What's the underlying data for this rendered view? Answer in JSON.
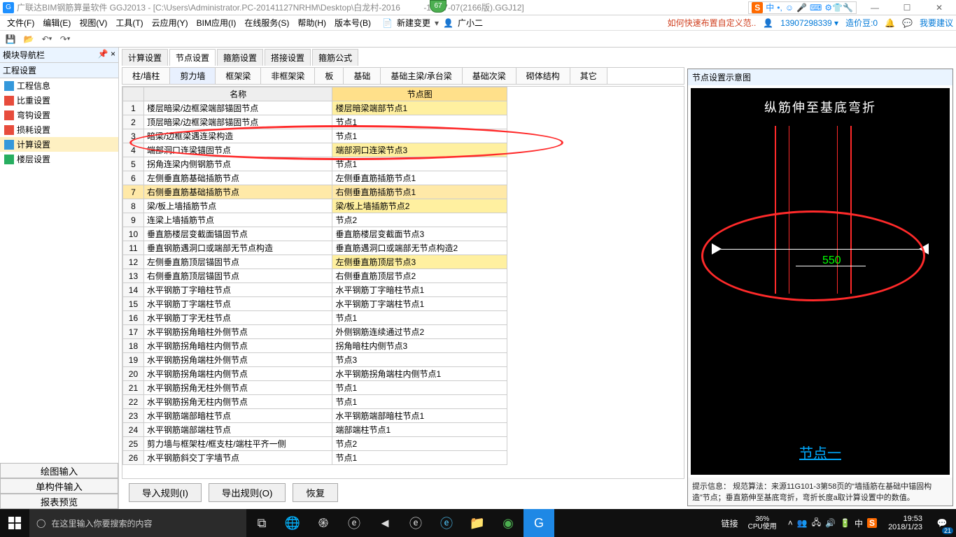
{
  "titlebar": {
    "app_name": "广联达BIM钢筋算量软件 GGJ2013",
    "file_path": "[C:\\Users\\Administrator.PC-20141127NRHM\\Desktop\\白龙村-2016",
    "file_suffix": "-13-27-07(2166版).GGJ12]",
    "badge": "67"
  },
  "ime": {
    "s": "S",
    "lang": "中",
    "punct": "•,",
    "emoji": "☺",
    "mic": "🎤",
    "kb": "⌨",
    "extras": "⚙👕🔧"
  },
  "winctrl": {
    "min": "—",
    "max": "☐",
    "close": "✕"
  },
  "menu": {
    "items": [
      "文件(F)",
      "编辑(E)",
      "视图(V)",
      "工具(T)",
      "云应用(Y)",
      "BIM应用(I)",
      "在线服务(S)",
      "帮助(H)",
      "版本号(B)"
    ],
    "new_change": "新建变更",
    "user": "广小二",
    "tip_link": "如何快速布置自定义范..",
    "phone": "13907298339",
    "price": "造价豆:0",
    "feedback": "我要建议"
  },
  "toolbar": {
    "save": "💾",
    "open": "📂",
    "undo": "↶",
    "redo": "↷"
  },
  "left": {
    "nav_title": "模块导航栏",
    "pin": "📌",
    "close": "×",
    "section": "工程设置",
    "items": [
      "工程信息",
      "比重设置",
      "弯钩设置",
      "损耗设置",
      "计算设置",
      "楼层设置"
    ],
    "selected_index": 4,
    "b1": "绘图输入",
    "b2": "单构件输入",
    "b3": "报表预览"
  },
  "tabs": {
    "main": [
      "计算设置",
      "节点设置",
      "箍筋设置",
      "搭接设置",
      "箍筋公式"
    ],
    "main_active": 1,
    "sub": [
      "柱/墙柱",
      "剪力墙",
      "框架梁",
      "非框架梁",
      "板",
      "基础",
      "基础主梁/承台梁",
      "基础次梁",
      "砌体结构",
      "其它"
    ],
    "sub_active": 1
  },
  "table": {
    "h1": "名称",
    "h2": "节点图",
    "rows": [
      {
        "n": "1",
        "a": "楼层暗梁/边框梁端部锚固节点",
        "b": "楼层暗梁端部节点1",
        "hl": true
      },
      {
        "n": "2",
        "a": "顶层暗梁/边框梁端部锚固节点",
        "b": "节点1"
      },
      {
        "n": "3",
        "a": "暗梁/边框梁遇连梁构造",
        "b": "节点1"
      },
      {
        "n": "4",
        "a": "端部洞口连梁锚固节点",
        "b": "端部洞口连梁节点3",
        "hl": true
      },
      {
        "n": "5",
        "a": "拐角连梁内侧钢筋节点",
        "b": "节点1"
      },
      {
        "n": "6",
        "a": "左侧垂直筋基础插筋节点",
        "b": "左侧垂直筋插筋节点1"
      },
      {
        "n": "7",
        "a": "右侧垂直筋基础插筋节点",
        "b": "右侧垂直筋插筋节点1",
        "sel": true
      },
      {
        "n": "8",
        "a": "梁/板上墙插筋节点",
        "b": "梁/板上墙插筋节点2",
        "hl": true
      },
      {
        "n": "9",
        "a": "连梁上墙插筋节点",
        "b": "节点2"
      },
      {
        "n": "10",
        "a": "垂直筋楼层变截面锚固节点",
        "b": "垂直筋楼层变截面节点3"
      },
      {
        "n": "11",
        "a": "垂直钢筋遇洞口或端部无节点构造",
        "b": "垂直筋遇洞口或端部无节点构造2"
      },
      {
        "n": "12",
        "a": "左侧垂直筋顶层锚固节点",
        "b": "左侧垂直筋顶层节点3",
        "hl": true
      },
      {
        "n": "13",
        "a": "右侧垂直筋顶层锚固节点",
        "b": "右侧垂直筋顶层节点2"
      },
      {
        "n": "14",
        "a": "水平钢筋丁字暗柱节点",
        "b": "水平钢筋丁字暗柱节点1"
      },
      {
        "n": "15",
        "a": "水平钢筋丁字端柱节点",
        "b": "水平钢筋丁字端柱节点1"
      },
      {
        "n": "16",
        "a": "水平钢筋丁字无柱节点",
        "b": "节点1"
      },
      {
        "n": "17",
        "a": "水平钢筋拐角暗柱外侧节点",
        "b": "外侧钢筋连续通过节点2"
      },
      {
        "n": "18",
        "a": "水平钢筋拐角暗柱内侧节点",
        "b": "拐角暗柱内侧节点3"
      },
      {
        "n": "19",
        "a": "水平钢筋拐角端柱外侧节点",
        "b": "节点3"
      },
      {
        "n": "20",
        "a": "水平钢筋拐角端柱内侧节点",
        "b": "水平钢筋拐角端柱内侧节点1"
      },
      {
        "n": "21",
        "a": "水平钢筋拐角无柱外侧节点",
        "b": "节点1"
      },
      {
        "n": "22",
        "a": "水平钢筋拐角无柱内侧节点",
        "b": "节点1"
      },
      {
        "n": "23",
        "a": "水平钢筋端部暗柱节点",
        "b": "水平钢筋端部暗柱节点1"
      },
      {
        "n": "24",
        "a": "水平钢筋端部端柱节点",
        "b": "端部端柱节点1"
      },
      {
        "n": "25",
        "a": "剪力墙与框架柱/框支柱/端柱平齐一侧",
        "b": "节点2"
      },
      {
        "n": "26",
        "a": "水平钢筋斜交丁字墙节点",
        "b": "节点1"
      }
    ]
  },
  "actions": {
    "import": "导入规则(I)",
    "export": "导出规则(O)",
    "restore": "恢复"
  },
  "preview": {
    "title": "节点设置示意图",
    "top_text": "纵筋伸至基底弯折",
    "dim": "550",
    "node_label": "节点一",
    "tip_label": "提示信息：",
    "tip_text": "规范算法：来源11G101-3第58页的“墙插筋在基础中锚固构造”节点；垂直筋伸至基底弯折，弯折长度a取计算设置中的数值。"
  },
  "taskbar": {
    "search_placeholder": "在这里输入你要搜索的内容",
    "link_label": "链接",
    "cpu_pct": "36%",
    "cpu_label": "CPU使用",
    "time": "19:53",
    "date": "2018/1/23",
    "notif_count": "21",
    "ime_s": "S",
    "ime_zh": "中"
  }
}
